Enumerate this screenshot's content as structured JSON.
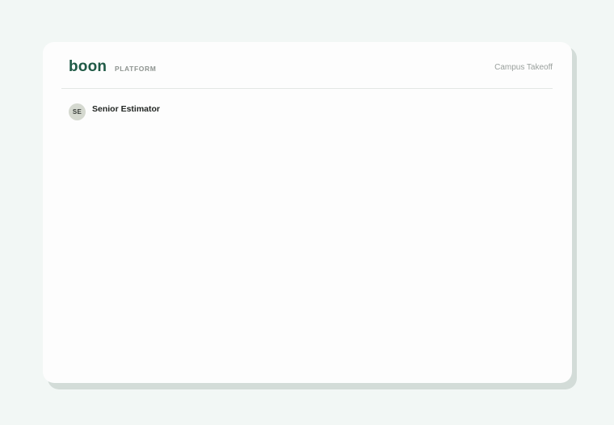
{
  "header": {
    "logo": "boon",
    "platform_label": "PLATFORM",
    "project_name": "Campus Takeoff"
  },
  "user": {
    "initials": "SE",
    "role": "Senior Estimator"
  }
}
